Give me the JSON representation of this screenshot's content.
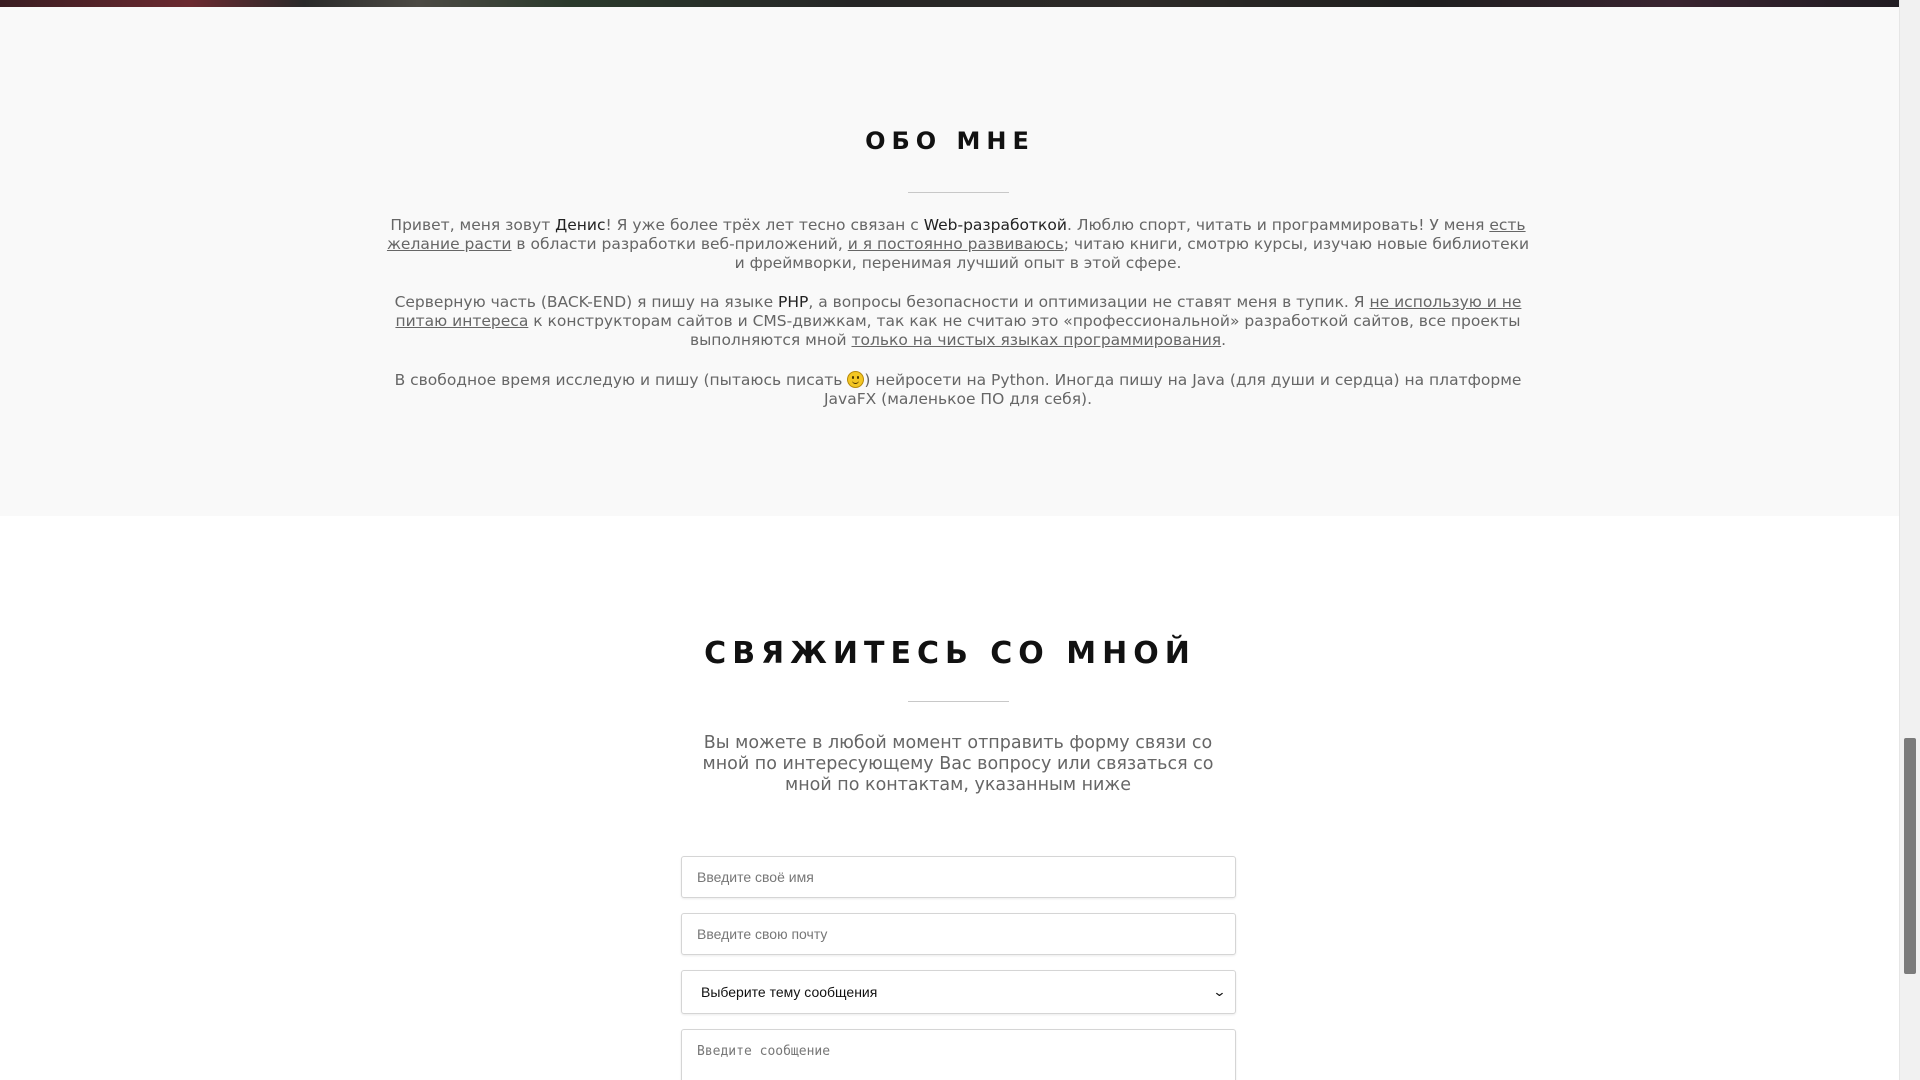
{
  "about": {
    "title": "ОБО МНЕ",
    "p1": {
      "t1": "Привет, меня зовут ",
      "name": "Денис",
      "t2": "! Я уже более трёх лет тесно связан с ",
      "web": "Web-разработкой",
      "t3": ". Люблю спорт, читать и программировать! У меня ",
      "u1": "есть желание расти",
      "t4": " в области разработки веб-приложений, ",
      "u2": "и я постоянно развиваюсь",
      "t5": "; читаю книги, смотрю курсы, изучаю новые библиотеки и фреймворки, перенимая лучший опыт в этой сфере."
    },
    "p2": {
      "t1": "Серверную часть (BACK-END) я пишу на языке ",
      "php": "PHP",
      "t2": ", а вопросы безопасности и оптимизации не ставят меня в тупик. Я ",
      "u1": "не использую и не питаю интереса",
      "t3": " к конструкторам сайтов и CMS-движкам, так как не считаю это «профессиональной» разработкой сайтов, все проекты выполняются мной ",
      "u2": "только на чистых языках программирования",
      "t4": "."
    },
    "p3": {
      "t1": "В свободное время исследую и пишу (пытаюсь писать ",
      "t2": ") нейросети на Python. Иногда пишу на Java (для души и сердца) на платформе JavaFX (маленькое ПО для себя)."
    }
  },
  "contact": {
    "title": "СВЯЖИТЕСЬ СО МНОЙ",
    "intro": "Вы можете в любой момент отправить форму связи со мной по интересующему Вас вопросу или связаться со мной по контактам, указанным ниже",
    "name_placeholder": "Введите своё имя",
    "email_placeholder": "Введите свою почту",
    "topic_selected": "Выберите тему сообщения",
    "message_placeholder": "Введите сообщение"
  },
  "icons": {
    "smile": "smiley-face-icon",
    "chevron": "chevron-down-icon"
  }
}
